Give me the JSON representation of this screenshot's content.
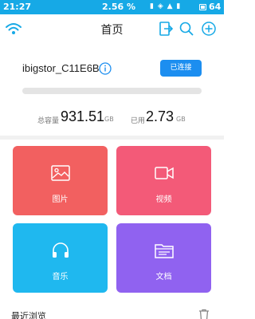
{
  "status_bar": {
    "time": "21:27",
    "network": "2.56 %",
    "battery": "64",
    "icons": "▮ ◈ ▲ ▮"
  },
  "header": {
    "title": "首页"
  },
  "device": {
    "name": "ibigstor_C11E6B",
    "connect_label": "已连接",
    "used_fraction": 0.0,
    "total_label": "总容量",
    "total_value": "931.51",
    "total_unit": "GB",
    "used_label": "已用",
    "used_value": "2.73",
    "used_unit": "GB"
  },
  "tiles": [
    {
      "label": "图片",
      "icon": "image-icon",
      "color": "#f26060"
    },
    {
      "label": "视频",
      "icon": "video-icon",
      "color": "#f35a78"
    },
    {
      "label": "音乐",
      "icon": "headphones-icon",
      "color": "#1fb8ef"
    },
    {
      "label": "文档",
      "icon": "folder-icon",
      "color": "#9062f0"
    }
  ],
  "recent": {
    "label": "最近浏览"
  }
}
